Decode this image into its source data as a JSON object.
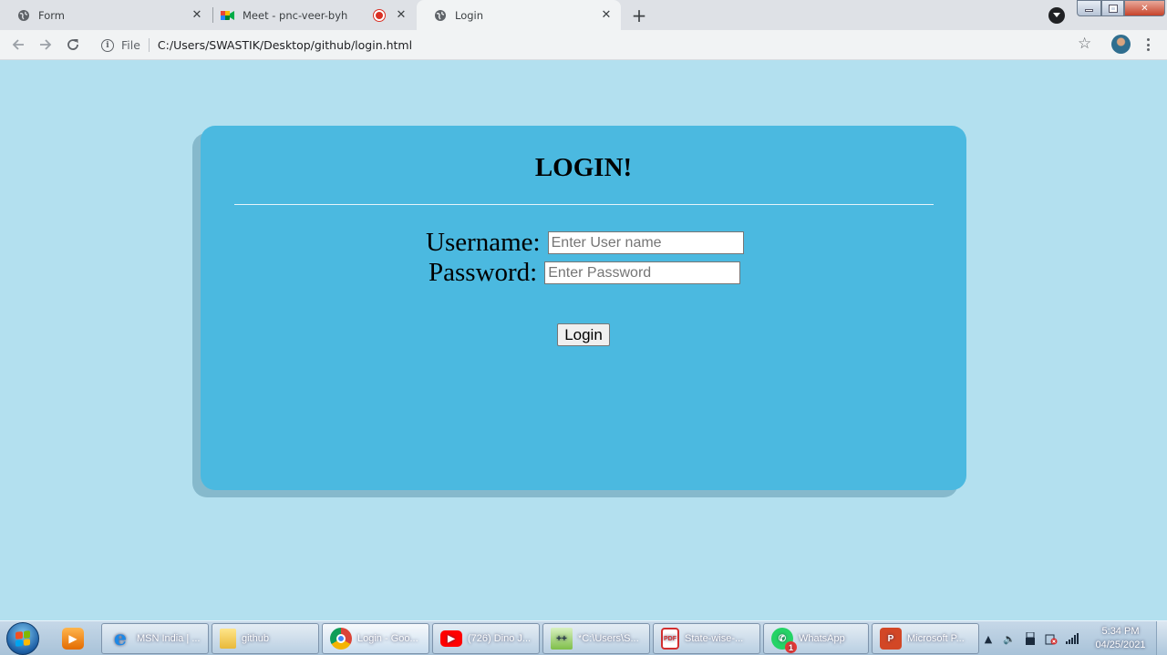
{
  "browser": {
    "tabs": [
      {
        "title": "Form",
        "icon": "globe-icon"
      },
      {
        "title": "Meet - pnc-veer-byh",
        "icon": "google-meet-icon",
        "recording": true
      },
      {
        "title": "Login",
        "icon": "globe-icon",
        "active": true
      }
    ],
    "address": {
      "scheme_label": "File",
      "url": "C:/Users/SWASTIK/Desktop/github/login.html"
    }
  },
  "page": {
    "background_color": "#b3e0ef",
    "card_color": "#4bb9e0",
    "heading": "LOGIN!",
    "username_label": "Username:",
    "username_placeholder": "Enter User name",
    "password_label": "Password:",
    "password_placeholder": "Enter Password",
    "submit_label": "Login"
  },
  "taskbar": {
    "items": [
      {
        "label": "MSN India | ...",
        "icon": "internet-explorer-icon"
      },
      {
        "label": "github",
        "icon": "folder-icon"
      },
      {
        "label": "Login - Goo...",
        "icon": "chrome-icon",
        "active": true
      },
      {
        "label": "(726) Dino J...",
        "icon": "youtube-icon"
      },
      {
        "label": "*C:\\Users\\S...",
        "icon": "notepad-plus-plus-icon"
      },
      {
        "label": "State-wise-...",
        "icon": "pdf-icon"
      },
      {
        "label": "WhatsApp",
        "icon": "whatsapp-icon",
        "badge": "1"
      },
      {
        "label": "Microsoft P...",
        "icon": "powerpoint-icon"
      }
    ],
    "clock": {
      "time": "5:34 PM",
      "date": "04/25/2021"
    }
  }
}
